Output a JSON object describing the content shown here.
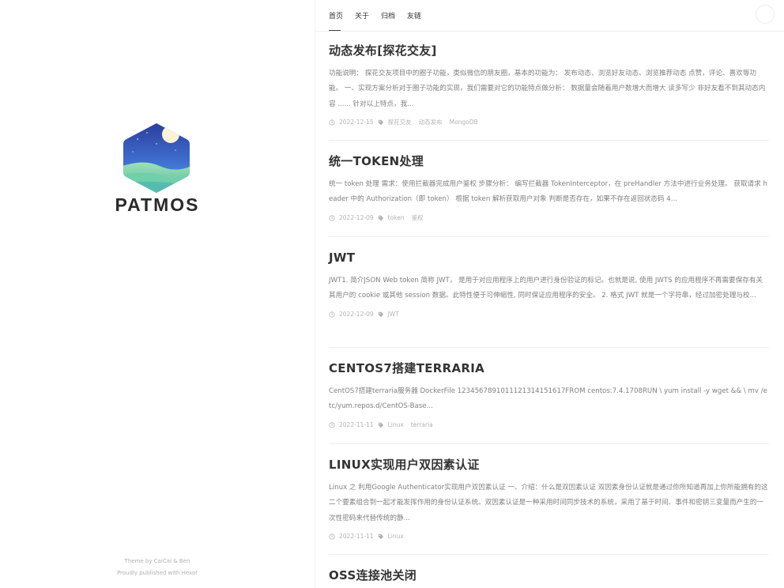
{
  "sidebar": {
    "brand": "PATMOS",
    "footer_theme_prefix": "Theme by ",
    "footer_author1": "CaiCai",
    "footer_amp": " & ",
    "footer_author2": "Ben",
    "footer_powered_prefix": "Proudly published with ",
    "footer_powered_link": "Hexo!"
  },
  "nav": {
    "items": [
      {
        "label": "首页"
      },
      {
        "label": "关于"
      },
      {
        "label": "归档"
      },
      {
        "label": "友链"
      }
    ]
  },
  "posts": [
    {
      "title": "动态发布[探花交友]",
      "excerpt": "功能说明：  探花交友项目中的圈子功能，类似微信的朋友圈，基本的功能为：  发布动态、浏览好友动态、浏览推荐动态 点赞，评论、喜欢等功能。  一、实现方案分析对于圈子功能的实现，我们需要对它的功能特点做分析：  数据量会随着用户数增大而增大 读多写少 非好友看不到其动态内容 ...... 针对以上特点，我...",
      "date": "2022-12-15",
      "tags": [
        "探花交友",
        "动态发布",
        "MongoDB"
      ]
    },
    {
      "title": "统一TOKEN处理",
      "excerpt": "统一 token 处理 需求：使用拦截器完成用户鉴权 步骤分析：  编写拦截器 TokenInterceptor，在 preHandler 方法中进行业务处理。 获取请求 header 中的 Authorization（即 token）  根据 token 解析获取用户对象 判断是否存在，如果不存在返回状态码 4...",
      "date": "2022-12-09",
      "tags": [
        "token",
        "鉴权"
      ]
    },
    {
      "title": "JWT",
      "excerpt": "JWT1. 简介JSON Web token 简称 JWT， 是用于对应用程序上的用户进行身份验证的标记。也就是说, 使用 JWTS 的应用程序不再需要保存有关其用户的 cookie 或其他 session 数据。此特性便于可伸缩性, 同时保证应用程序的安全。 2. 格式 JWT 就是一个字符串，经过加密处理与校...",
      "date": "2022-12-09",
      "tags": [
        "JWT"
      ]
    },
    {
      "title": "CENTOS7搭建TERRARIA",
      "excerpt": "CentOS7搭建terraria服务器 DockerFile 1234567891011121314151617FROM centos:7.4.1708RUN \\ yum install -y wget && \\ mv /etc/yum.repos.d/CentOS-Base...",
      "date": "2022-11-11",
      "tags": [
        "Linux",
        "terraria"
      ]
    },
    {
      "title": "LINUX实现用户双因素认证",
      "excerpt": "Linux 之 利用Google Authenticator实现用户双因素认证 一、介绍：什么是双因素认证        双因素身份认证就是通过你所知道再加上你所能拥有的这二个要素组合到一起才能发挥作用的身份认证系统。双因素认证是一种采用时间同步技术的系统，采用了基于时间、事件和密钥三变量而产生的一次性密码来代替传统的静...",
      "date": "2022-11-11",
      "tags": [
        "Linux"
      ]
    },
    {
      "title": "OSS连接池关闭",
      "excerpt": "",
      "date": "",
      "tags": []
    }
  ],
  "colors": {
    "accent": "#333333",
    "muted_text": "#808080",
    "meta_text": "#b2b2b2",
    "divider": "#eeeeee"
  },
  "icons": {
    "date": "clock-icon",
    "tag": "tag-icon",
    "logo": "hexagon-night-landscape-logo",
    "menu": "menu-circle-icon"
  }
}
